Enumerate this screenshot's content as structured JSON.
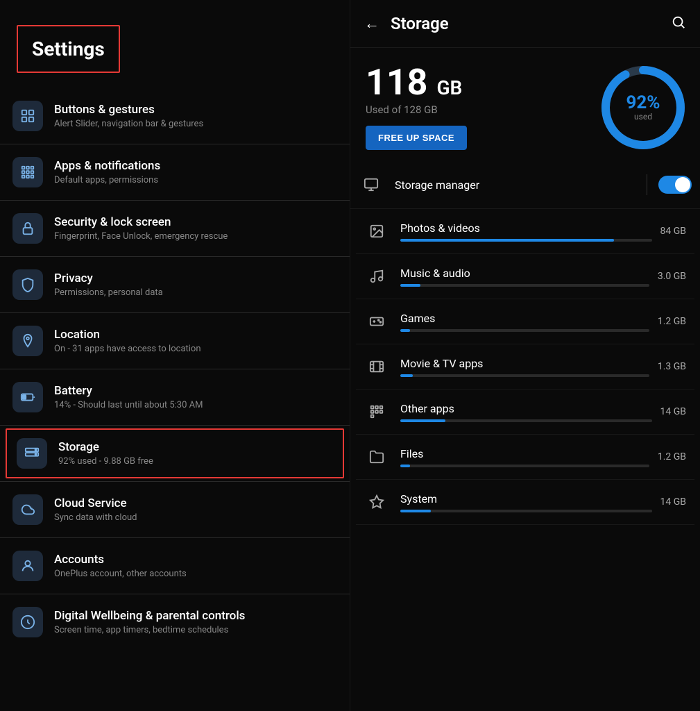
{
  "left": {
    "title": "Settings",
    "items": [
      {
        "id": "buttons-gestures",
        "icon": "⊞",
        "title": "Buttons & gestures",
        "subtitle": "Alert Slider, navigation bar & gestures",
        "active": false
      },
      {
        "id": "apps-notifications",
        "icon": "⊞",
        "title": "Apps & notifications",
        "subtitle": "Default apps, permissions",
        "active": false
      },
      {
        "id": "security",
        "icon": "🔒",
        "title": "Security & lock screen",
        "subtitle": "Fingerprint, Face Unlock, emergency rescue",
        "active": false
      },
      {
        "id": "privacy",
        "icon": "🔒",
        "title": "Privacy",
        "subtitle": "Permissions, personal data",
        "active": false
      },
      {
        "id": "location",
        "icon": "📍",
        "title": "Location",
        "subtitle": "On - 31 apps have access to location",
        "active": false
      },
      {
        "id": "battery",
        "icon": "🔋",
        "title": "Battery",
        "subtitle": "14% - Should last until about 5:30 AM",
        "active": false
      },
      {
        "id": "storage",
        "icon": "💾",
        "title": "Storage",
        "subtitle": "92% used - 9.88 GB free",
        "active": true
      },
      {
        "id": "cloud",
        "icon": "☁",
        "title": "Cloud Service",
        "subtitle": "Sync data with cloud",
        "active": false
      },
      {
        "id": "accounts",
        "icon": "👤",
        "title": "Accounts",
        "subtitle": "OnePlus account, other accounts",
        "active": false
      },
      {
        "id": "digital-wellbeing",
        "icon": "⏱",
        "title": "Digital Wellbeing & parental controls",
        "subtitle": "Screen time, app timers, bedtime schedules",
        "active": false
      }
    ]
  },
  "right": {
    "title": "Storage",
    "back_label": "←",
    "storage_used": "118",
    "storage_unit": "GB",
    "storage_of": "Used of 128 GB",
    "free_up_btn": "FREE UP SPACE",
    "circle_percent": "92%",
    "circle_used_label": "used",
    "storage_manager_label": "Storage manager",
    "items": [
      {
        "id": "photos-videos",
        "icon": "🖼",
        "label": "Photos & videos",
        "size": "84 GB",
        "bar_percent": 85
      },
      {
        "id": "music-audio",
        "icon": "♪",
        "label": "Music & audio",
        "size": "3.0 GB",
        "bar_percent": 8
      },
      {
        "id": "games",
        "icon": "🎮",
        "label": "Games",
        "size": "1.2 GB",
        "bar_percent": 4
      },
      {
        "id": "movie-tv",
        "icon": "🎬",
        "label": "Movie & TV apps",
        "size": "1.3 GB",
        "bar_percent": 5
      },
      {
        "id": "other-apps",
        "icon": "⊞",
        "label": "Other apps",
        "size": "14 GB",
        "bar_percent": 18
      },
      {
        "id": "files",
        "icon": "📁",
        "label": "Files",
        "size": "1.2 GB",
        "bar_percent": 4
      },
      {
        "id": "system",
        "icon": "⬇",
        "label": "System",
        "size": "14 GB",
        "bar_percent": 12
      }
    ]
  }
}
